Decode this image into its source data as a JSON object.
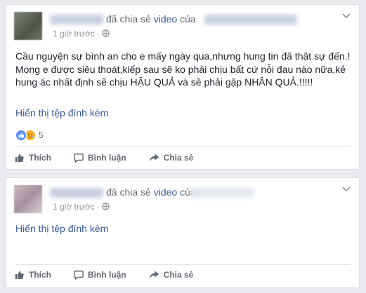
{
  "posts": [
    {
      "action": "đã chia sẻ",
      "object": "video",
      "of": "của",
      "time": "1 giờ trước",
      "text": "Cầu nguyện sự bình an cho e mấy ngày qua,nhưng hung tin đã thật sự đến.! Mong e được siêu thoát,kiếp sau sẽ ko phải chịu bất cứ nỗi đau nào nữa,kẻ hung ác nhất định sẽ chịu HẬU QUẢ và sẽ phải gặp NHÂN QUẢ.!!!!!",
      "attachment": "Hiển thị tệp đính kèm",
      "reaction_count": "5"
    },
    {
      "action": "đã chia sẻ",
      "object": "video",
      "of": "của",
      "time": "1 giờ trước",
      "attachment": "Hiển thị tệp đính kèm"
    }
  ],
  "actions": {
    "like": "Thích",
    "comment": "Bình luận",
    "share": "Chia sẻ"
  },
  "colors": {
    "link": "#365899",
    "meta": "#90949c",
    "action": "#616770",
    "like_reaction": "#5890ff",
    "sad_reaction": "#f7b125"
  },
  "icons": [
    "globe-icon",
    "chevron-down-icon",
    "like-icon",
    "comment-icon",
    "share-icon",
    "like-reaction-icon",
    "sad-reaction-icon"
  ]
}
